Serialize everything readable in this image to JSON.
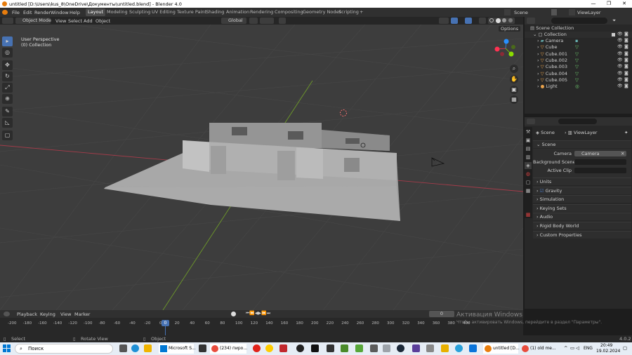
{
  "title_bar": {
    "title": "untitled [D:\\Users\\kus_8\\OneDrive\\Документы\\untitled.blend] - Blender 4.0",
    "minimize": "—",
    "maximize": "❐",
    "close": "✕"
  },
  "menu": {
    "items": [
      "File",
      "Edit",
      "Render",
      "Window",
      "Help"
    ],
    "workspaces": [
      "Layout",
      "Modeling",
      "Sculpting",
      "UV Editing",
      "Texture Paint",
      "Shading",
      "Animation",
      "Rendering",
      "Compositing",
      "Geometry Nodes",
      "Scripting"
    ],
    "active_workspace": "Layout",
    "add_workspace": "+",
    "scene": "Scene",
    "view_layer": "ViewLayer"
  },
  "viewport_header": {
    "mode": "Object Mode",
    "menus": [
      "View",
      "Select",
      "Add",
      "Object"
    ],
    "orientation": "Global",
    "options": "Options"
  },
  "viewport": {
    "perspective": "User Perspective",
    "collection": "(0) Collection",
    "accent": "#4772b3",
    "axis_x_color": "#ff3352",
    "axis_y_color": "#8bdc00",
    "axis_z_color": "#2890ff"
  },
  "tools": [
    "cursor-tool",
    "select-box-tool",
    "move-tool",
    "rotate-tool",
    "scale-tool",
    "transform-tool",
    "annotate-tool",
    "measure-tool",
    "add-cube-tool"
  ],
  "outliner": {
    "search_placeholder": "",
    "root": "Scene Collection",
    "collection": "Collection",
    "items": [
      {
        "name": "Camera",
        "icon": "camera-icon"
      },
      {
        "name": "Cube",
        "icon": "mesh-icon"
      },
      {
        "name": "Cube.001",
        "icon": "mesh-icon"
      },
      {
        "name": "Cube.002",
        "icon": "mesh-icon"
      },
      {
        "name": "Cube.003",
        "icon": "mesh-icon"
      },
      {
        "name": "Cube.004",
        "icon": "mesh-icon"
      },
      {
        "name": "Cube.005",
        "icon": "mesh-icon"
      },
      {
        "name": "Light",
        "icon": "light-icon"
      }
    ]
  },
  "properties": {
    "breadcrumb_scene": "Scene",
    "breadcrumb_layer": "ViewLayer",
    "section_scene": "Scene",
    "camera_label": "Camera",
    "camera_value": "Camera",
    "background_label": "Background Scene",
    "active_clip_label": "Active Clip",
    "panels": [
      "Units",
      "Gravity",
      "Simulation",
      "Keying Sets",
      "Audio",
      "Rigid Body World",
      "Custom Properties"
    ]
  },
  "timeline": {
    "menus": [
      "Playback",
      "Keying",
      "View",
      "Marker"
    ],
    "current_frame": "0",
    "frame_field": "0",
    "ticks": [
      "-200",
      "-180",
      "-160",
      "-140",
      "-120",
      "-100",
      "-80",
      "-60",
      "-40",
      "-20",
      "0",
      "20",
      "40",
      "60",
      "80",
      "100",
      "120",
      "140",
      "160",
      "180",
      "200",
      "220",
      "240",
      "260",
      "280",
      "300",
      "320",
      "340",
      "360",
      "380",
      "400"
    ]
  },
  "watermark": {
    "line1": "Активация Windows",
    "line2": "Чтобы активировать Windows, перейдите в раздел \"Параметры\"."
  },
  "status_bar": {
    "select": "Select",
    "rotate_view": "Rotate View",
    "object": "Object",
    "version": "4.0.2"
  },
  "taskbar": {
    "search": "Поиск",
    "apps": [
      "Microsoft S...",
      "(234) пиро...",
      "untitled [D...",
      "(1) old me..."
    ],
    "lang": "ENG",
    "time": "20:49",
    "date": "19.02.2024"
  }
}
